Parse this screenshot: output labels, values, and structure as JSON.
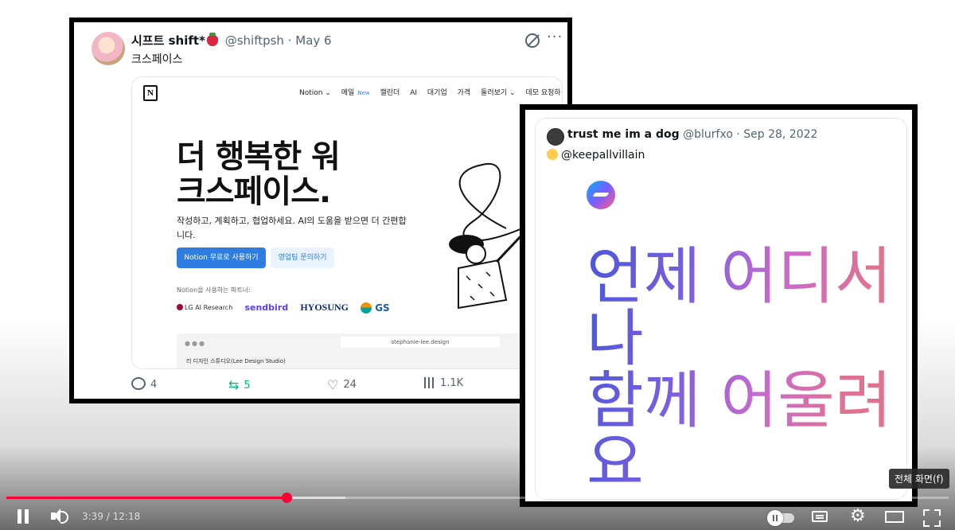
{
  "tweet1": {
    "display_name": "시프트 shift*",
    "handle": "@shiftpsh",
    "date": "May 6",
    "text": "크스페이스",
    "notion": {
      "nav": [
        "Notion ⌄",
        "메일",
        "캘린더",
        "AI",
        "대기업",
        "가격",
        "둘러보기 ⌄",
        "데모 요청하"
      ],
      "nav_badge": "New",
      "headline_line1": "더 행복한 워",
      "headline_line2": "크스페이스.",
      "description": "작성하고, 계획하고, 협업하세요. AI의 도움을 받으면 더 간편합니다.",
      "primary_button": "Notion 무료로 사용하기",
      "secondary_button": "영업팀 문의하기",
      "partners_label": "Notion을 사용하는 파트너:",
      "partners": [
        "LG AI Research",
        "sendbird",
        "HYOSUNG",
        "GS"
      ],
      "browser_url": "stephanie-lee.design",
      "browser_page_title": "리 디자인 스튜디오(Lee Design Studio)"
    },
    "actions": {
      "replies": "4",
      "retweets": "5",
      "likes": "24",
      "views": "1.1K"
    }
  },
  "tweet2": {
    "display_name": "trust me im a dog",
    "handle": "@blurfxo",
    "date": "Sep 28, 2022",
    "text": "@keepallvillain",
    "big_text_lines": [
      "언제 어디서",
      "나",
      "함께 어울려",
      "요"
    ]
  },
  "player": {
    "time_current": "3:39",
    "time_total": "12:18",
    "progress_fraction": 0.297,
    "buffered_fraction": 0.36,
    "tooltip": "전체 화면(f)",
    "accent_color": "#ff0033"
  }
}
